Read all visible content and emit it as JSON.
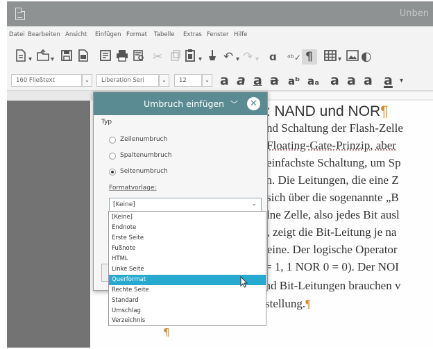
{
  "window": {
    "title": "Unben"
  },
  "menubar": [
    "Datei",
    "Bearbeiten",
    "Ansicht",
    "Einfügen",
    "Format",
    "Tabelle",
    "Extras",
    "Fenster",
    "Hilfe"
  ],
  "toolbar": {
    "style_value": "160 Fließtext",
    "font_value": "Liberation Seri",
    "size_value": "12",
    "char_buttons": [
      "a",
      "a",
      "a",
      "a",
      "aᵇ",
      "aₐ",
      "a",
      "a",
      "a",
      "a"
    ]
  },
  "document": {
    "heading_tail": "n: NAND und NOR",
    "lines": [
      "nd Schaltung der Flash-Zelle",
      "Floating-Gate-Prinzip, aber",
      "einfachste Schaltung, um Sp",
      "en. Die Leitungen, die eine Z",
      "sich über die sogenannte „B",
      "lne Zelle, also jedes Bit ausl",
      "n, zeigt die Bit-Leitung je na",
      "teine. Der logische Operator",
      "= 1, 1 NOR 0 = 0). Der NOI",
      "and Bit-Leitungen brauchen v",
      "stellung."
    ],
    "pilcrow": "¶"
  },
  "dialog": {
    "title": "Umbruch einfügen",
    "section_label": "Typ",
    "options": [
      "Zeilenumbruch",
      "Spaltenumbruch",
      "Seitenumbruch"
    ],
    "selected_option": "Seitenumbruch",
    "format_label": "Formatvorlage:",
    "format_value": "[Keine]",
    "list_items": [
      "[Keine]",
      "Endnote",
      "Erste Seite",
      "Fußnote",
      "HTML",
      "Linke Seite",
      "Querformat",
      "Rechte Seite",
      "Standard",
      "Umschlag",
      "Verzeichnis"
    ],
    "highlighted_item": "Querformat"
  },
  "colors": {
    "dialog_title_bg": "#5b8b92",
    "selection": "#28a9d0",
    "doc_bg": "#737373"
  }
}
